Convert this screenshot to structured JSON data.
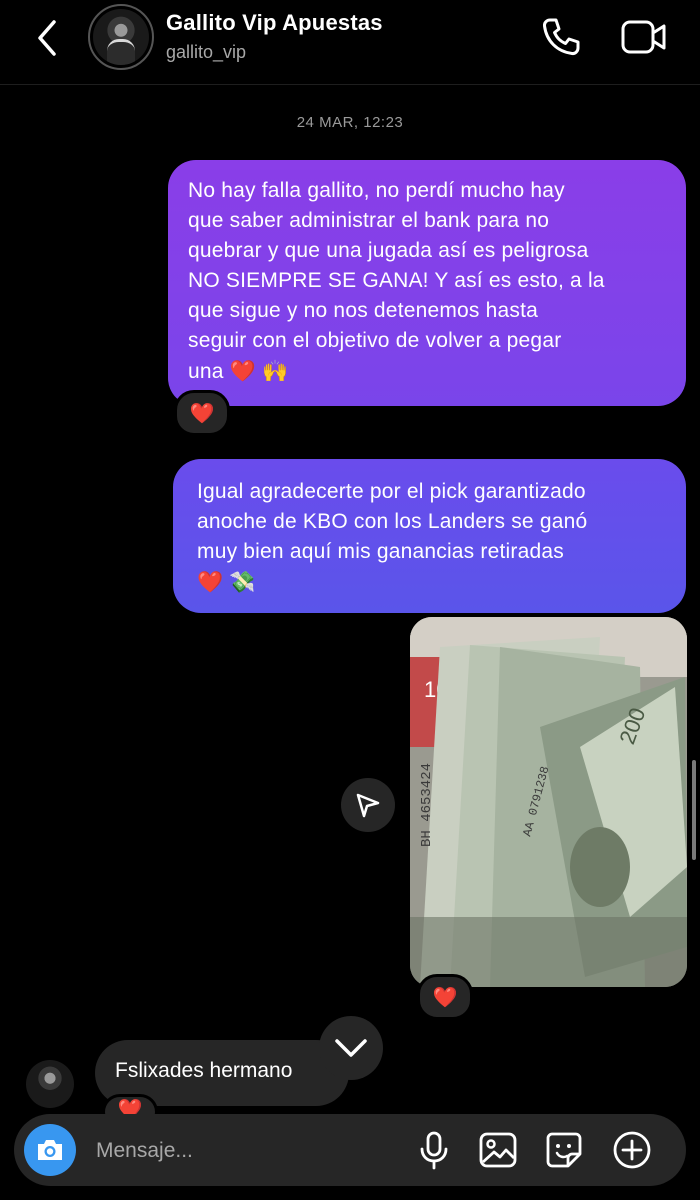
{
  "header": {
    "title": "Gallito Vip Apuestas",
    "username": "gallito_vip"
  },
  "conversation": {
    "timestamp": "24 MAR, 12:23",
    "messages": [
      {
        "direction": "outgoing",
        "text": "No hay falla gallito, no perdí mucho hay\nque saber administrar el bank para no\nquebrar y que una jugada así es peligrosa\nNO SIEMPRE SE GANA! Y así es esto, a la\nque sigue y no nos detenemos hasta\nseguir con el objetivo de volver a pegar\nuna",
        "emojis": [
          "❤️",
          "🙌"
        ],
        "reaction": "❤️",
        "bubble_color": "#8a3ee8"
      },
      {
        "direction": "outgoing",
        "text": "Igual agradecerte por el pick garantizado\nanoche de KBO con los Landers se ganó\nmuy bien aquí mis ganancias retiradas",
        "emojis": [
          "❤️",
          "💸"
        ],
        "bubble_color": "#6a4cec"
      },
      {
        "direction": "outgoing",
        "type": "photo",
        "reaction": "❤️"
      },
      {
        "direction": "incoming",
        "text": "Fslixades hermano",
        "reaction": "❤️"
      }
    ]
  },
  "composer": {
    "placeholder": "Mensaje..."
  },
  "colors": {
    "background": "#000000",
    "incoming_bubble": "#262626",
    "camera_button": "#3897f0",
    "reaction_heart": "#ff1e3c"
  },
  "icons": {
    "back": "chevron-left-icon",
    "call": "phone-icon",
    "video": "video-camera-icon",
    "share": "send-icon",
    "scroll_down": "chevron-down-icon",
    "camera": "camera-icon",
    "mic": "microphone-icon",
    "gallery": "image-icon",
    "sticker": "sticker-icon",
    "plus": "plus-circle-icon"
  }
}
